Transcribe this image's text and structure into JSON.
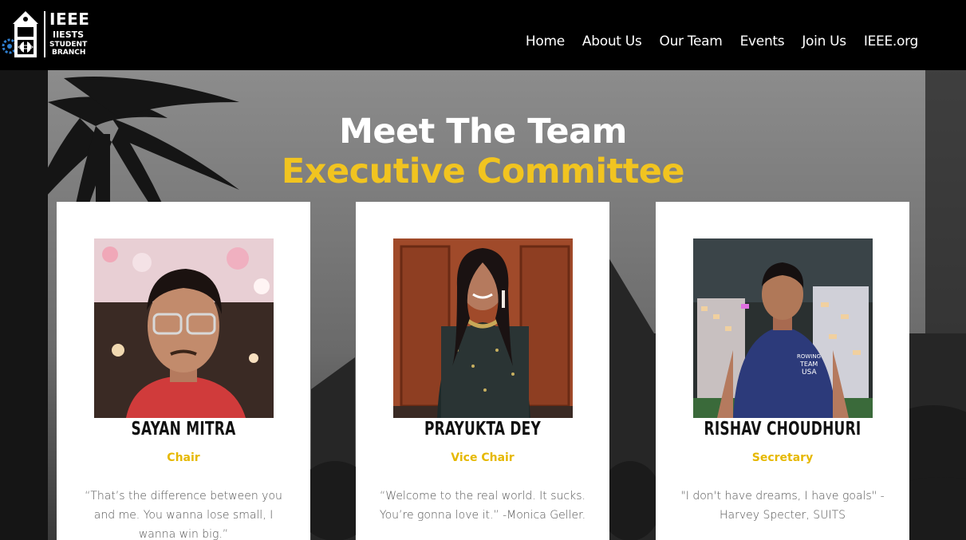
{
  "logo": {
    "line1": "IEEE",
    "line2": "IIESTS",
    "line3": "STUDENT",
    "line4": "BRANCH",
    "icon": "ieee-iiests-logo-icon"
  },
  "nav": {
    "items": [
      {
        "label": "Home"
      },
      {
        "label": "About Us"
      },
      {
        "label": "Our Team"
      },
      {
        "label": "Events"
      },
      {
        "label": "Join Us"
      },
      {
        "label": "IEEE.org"
      }
    ]
  },
  "hero": {
    "title": "Meet The Team",
    "subtitle": "Executive Committee"
  },
  "colors": {
    "accent": "#f1c420",
    "role": "#e6b800",
    "header_bg": "#000000",
    "card_bg": "#ffffff"
  },
  "members": [
    {
      "name": "SAYAN MITRA",
      "role": "Chair",
      "quote": "“That’s the difference between you and me. You wanna lose small, I wanna win big.”",
      "photo": "member-photo"
    },
    {
      "name": "PRAYUKTA DEY",
      "role": "Vice Chair",
      "quote": "“Welcome to the real world. It sucks. You’re gonna love it.” -Monica Geller.",
      "photo": "member-photo"
    },
    {
      "name": "RISHAV CHOUDHURI",
      "role": "Secretary",
      "quote": "\"I don't have dreams, I have goals\" -Harvey Specter, SUITS",
      "photo": "member-photo"
    }
  ]
}
